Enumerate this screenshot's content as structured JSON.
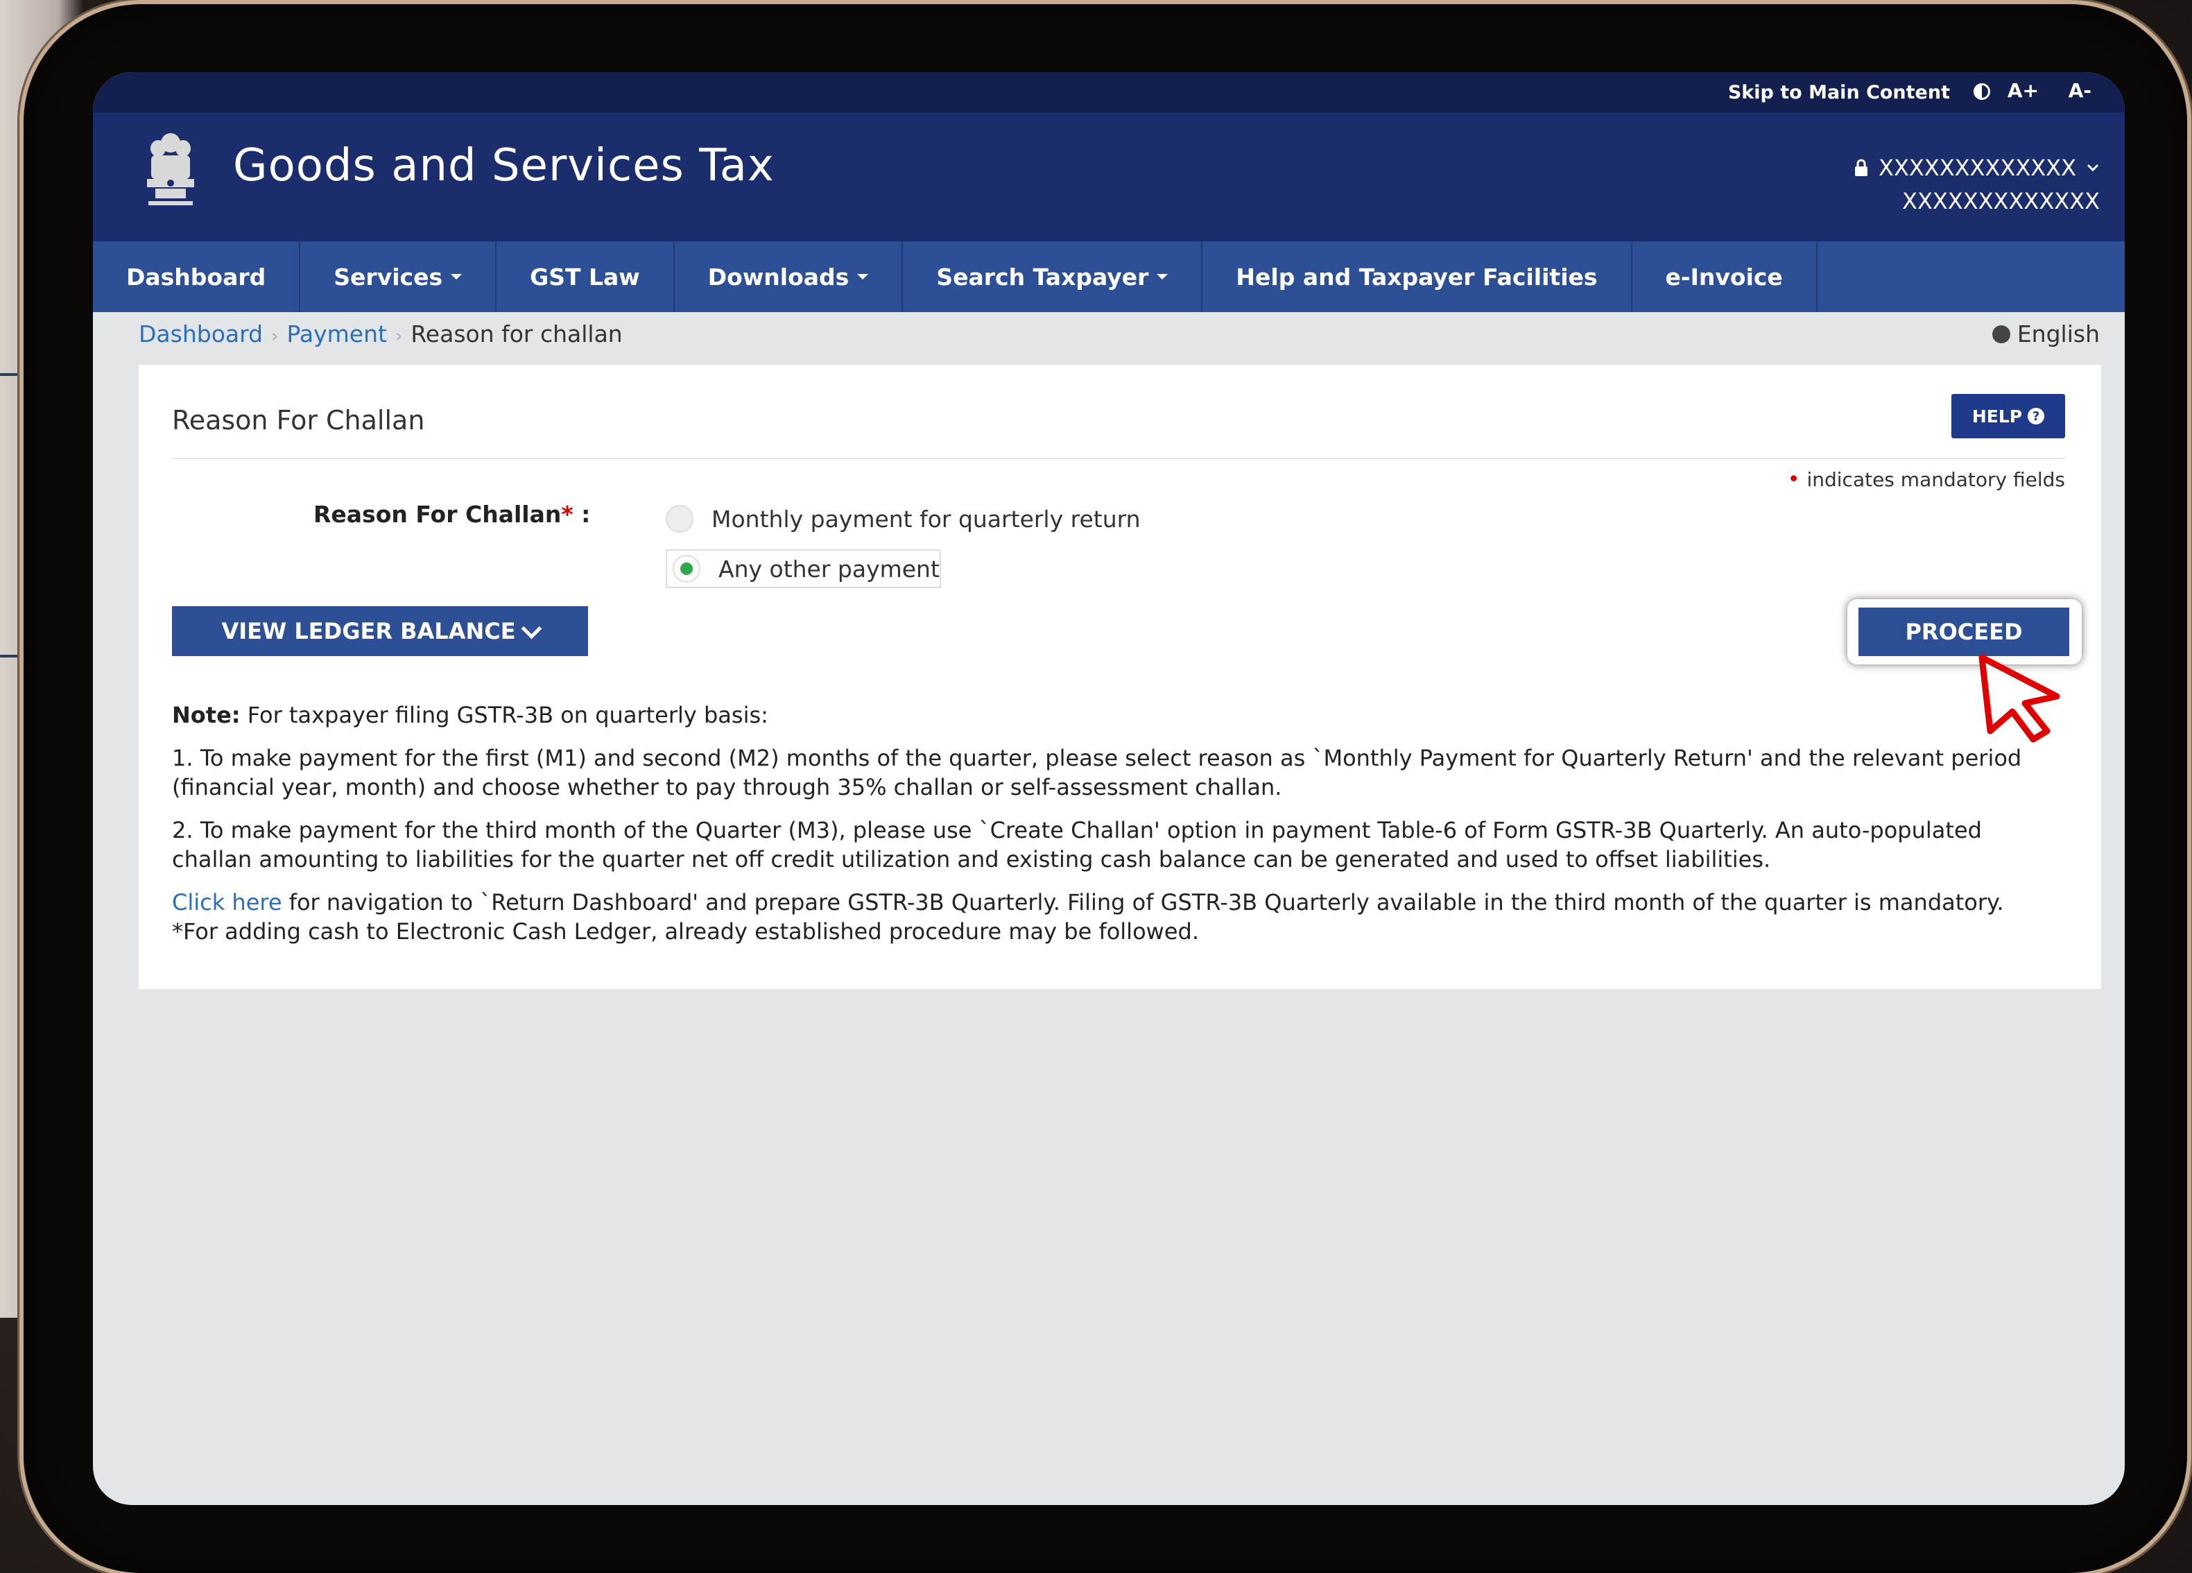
{
  "topbar": {
    "skip_label": "Skip to Main Content",
    "increase_font": "A+",
    "decrease_font": "A-"
  },
  "header": {
    "site_title": "Goods and Services Tax",
    "user_line1": "XXXXXXXXXXXXX",
    "user_line2": "XXXXXXXXXXXXX"
  },
  "nav": {
    "items": [
      {
        "label": "Dashboard"
      },
      {
        "label": "Services"
      },
      {
        "label": "GST Law"
      },
      {
        "label": "Downloads"
      },
      {
        "label": "Search Taxpayer"
      },
      {
        "label": "Help and Taxpayer Facilities"
      },
      {
        "label": "e-Invoice"
      }
    ]
  },
  "breadcrumb": {
    "items": [
      "Dashboard",
      "Payment",
      "Reason for challan"
    ],
    "language": "English"
  },
  "panel": {
    "title": "Reason For Challan",
    "help_label": "HELP",
    "mandatory_note": "indicates mandatory fields",
    "field_label": "Reason For Challan",
    "options": [
      {
        "label": "Monthly payment for quarterly return",
        "selected": false
      },
      {
        "label": "Any other payment",
        "selected": true
      }
    ],
    "view_ledger_label": "VIEW LEDGER BALANCE",
    "proceed_label": "PROCEED"
  },
  "note": {
    "heading": "Note:",
    "heading_text": "For taxpayer filing GSTR-3B on quarterly basis:",
    "point1": "1. To make payment for the first (M1) and second (M2) months of the quarter, please select reason as `Monthly Payment for Quarterly Return' and the relevant period (financial year, month) and choose whether to pay through 35% challan or self-assessment challan.",
    "point2": "2. To make payment for the third month of the Quarter (M3), please use `Create Challan' option in payment Table-6 of Form GSTR-3B Quarterly. An auto-populated challan amounting to liabilities for the quarter net off credit utilization and existing cash balance can be generated and used to offset liabilities.",
    "click_here": "Click here",
    "click_text": "for navigation to `Return Dashboard' and prepare GSTR-3B Quarterly. Filing of GSTR-3B Quarterly available in the third month of the quarter is mandatory.",
    "cash_ledger": "*For adding cash to Electronic Cash Ledger, already established procedure may be followed."
  },
  "colors": {
    "header_bg": "#1c2d6e",
    "nav_bg": "#2c4f96",
    "button_bg": "#2c4f96",
    "link": "#2a6ebb",
    "radio_selected": "#2ea84a",
    "cursor": "#e00000"
  }
}
